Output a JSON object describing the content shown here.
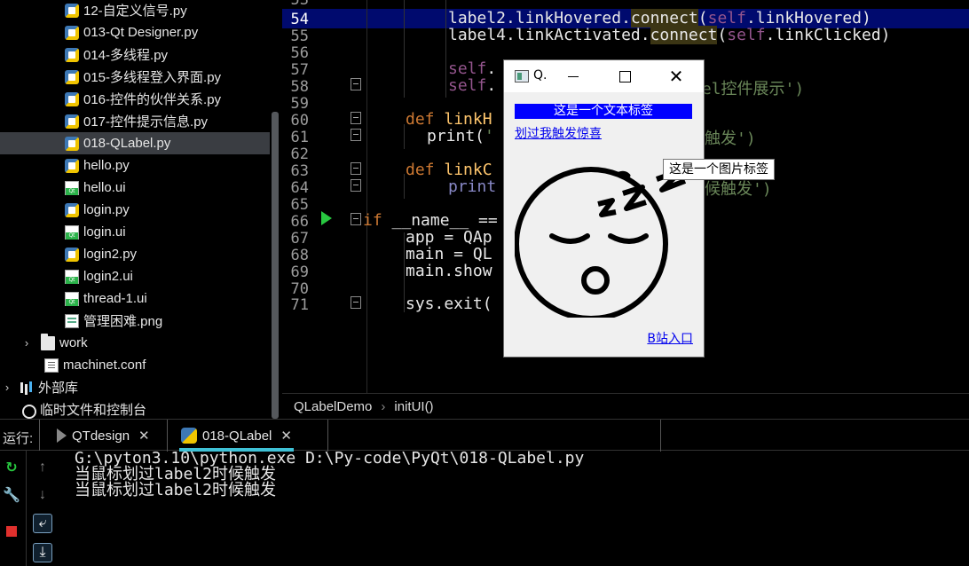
{
  "project_tree": {
    "items": [
      {
        "label": "12-自定义信号.py",
        "icon": "python-file-icon",
        "selected": false
      },
      {
        "label": "013-Qt Designer.py",
        "icon": "python-file-icon",
        "selected": false
      },
      {
        "label": "014-多线程.py",
        "icon": "python-file-icon",
        "selected": false
      },
      {
        "label": "015-多线程登入界面.py",
        "icon": "python-file-icon",
        "selected": false
      },
      {
        "label": "016-控件的伙伴关系.py",
        "icon": "python-file-icon",
        "selected": false
      },
      {
        "label": "017-控件提示信息.py",
        "icon": "python-file-icon",
        "selected": false
      },
      {
        "label": "018-QLabel.py",
        "icon": "python-file-icon",
        "selected": true
      },
      {
        "label": "hello.py",
        "icon": "python-file-icon",
        "selected": false
      },
      {
        "label": "hello.ui",
        "icon": "qt-ui-file-icon",
        "selected": false
      },
      {
        "label": "login.py",
        "icon": "python-file-icon",
        "selected": false
      },
      {
        "label": "login.ui",
        "icon": "qt-ui-file-icon",
        "selected": false
      },
      {
        "label": "login2.py",
        "icon": "python-file-icon",
        "selected": false
      },
      {
        "label": "login2.ui",
        "icon": "qt-ui-file-icon",
        "selected": false
      },
      {
        "label": "thread-1.ui",
        "icon": "qt-ui-file-icon",
        "selected": false
      },
      {
        "label": "管理困难.png",
        "icon": "image-file-icon",
        "selected": false
      }
    ],
    "work_folder": "work",
    "machinet_conf": "machinet.conf",
    "external_libs": "外部库",
    "scratches": "临时文件和控制台"
  },
  "editor": {
    "current_line": 54,
    "lines": [
      {
        "n": 53,
        "text": ""
      },
      {
        "n": 54,
        "text": "label2.linkHovered.connect(self.linkHovered)"
      },
      {
        "n": 55,
        "text": "label4.linkActivated.connect(self.linkClicked)"
      },
      {
        "n": 56,
        "text": ""
      },
      {
        "n": 57,
        "text": "self."
      },
      {
        "n": 58,
        "text": "self."
      },
      {
        "n": 59,
        "text": ""
      },
      {
        "n": 60,
        "text": "def linkH"
      },
      {
        "n": 61,
        "text": "print('"
      },
      {
        "n": 62,
        "text": ""
      },
      {
        "n": 63,
        "text": "def linkC"
      },
      {
        "n": 64,
        "text": "print"
      },
      {
        "n": 65,
        "text": ""
      },
      {
        "n": 66,
        "text": "if __name__ == "
      },
      {
        "n": 67,
        "text": "app = QAp"
      },
      {
        "n": 68,
        "text": "main = QL"
      },
      {
        "n": 69,
        "text": "main.show"
      },
      {
        "n": 70,
        "text": ""
      },
      {
        "n": 71,
        "text": "sys.exit("
      }
    ],
    "fragments": {
      "line58_tail": "bel控件展示')",
      "line61_tail": "触发')",
      "line64_tail": "候触发')"
    }
  },
  "breadcrumb": {
    "items": [
      "QLabelDemo",
      "initUI()"
    ]
  },
  "run_panel": {
    "label": "运行:",
    "tabs": [
      {
        "label": "QTdesign",
        "icon": "run-config-icon",
        "active": false
      },
      {
        "label": "018-QLabel",
        "icon": "python-icon",
        "active": true
      }
    ],
    "console_lines": [
      "G:\\pyton3.10\\python.exe D:\\Py-code\\PyQt\\018-QLabel.py",
      "当鼠标划过label2时候触发",
      "当鼠标划过label2时候触发"
    ]
  },
  "qt_window": {
    "title": "Q.",
    "label1": "这是一个文本标签",
    "label2": "划过我触发惊喜",
    "label4": "B站入口",
    "tooltip": "这是一个图片标签",
    "label1_bg": "#0000ff",
    "link_color": "#0000ee"
  },
  "colors": {
    "current_line_bg": "#000a6e",
    "keyword": "#cc7832",
    "self": "#94558d",
    "string": "#6a8759",
    "function": "#ffc66d",
    "active_tab_underline": "#3fc1d6"
  }
}
